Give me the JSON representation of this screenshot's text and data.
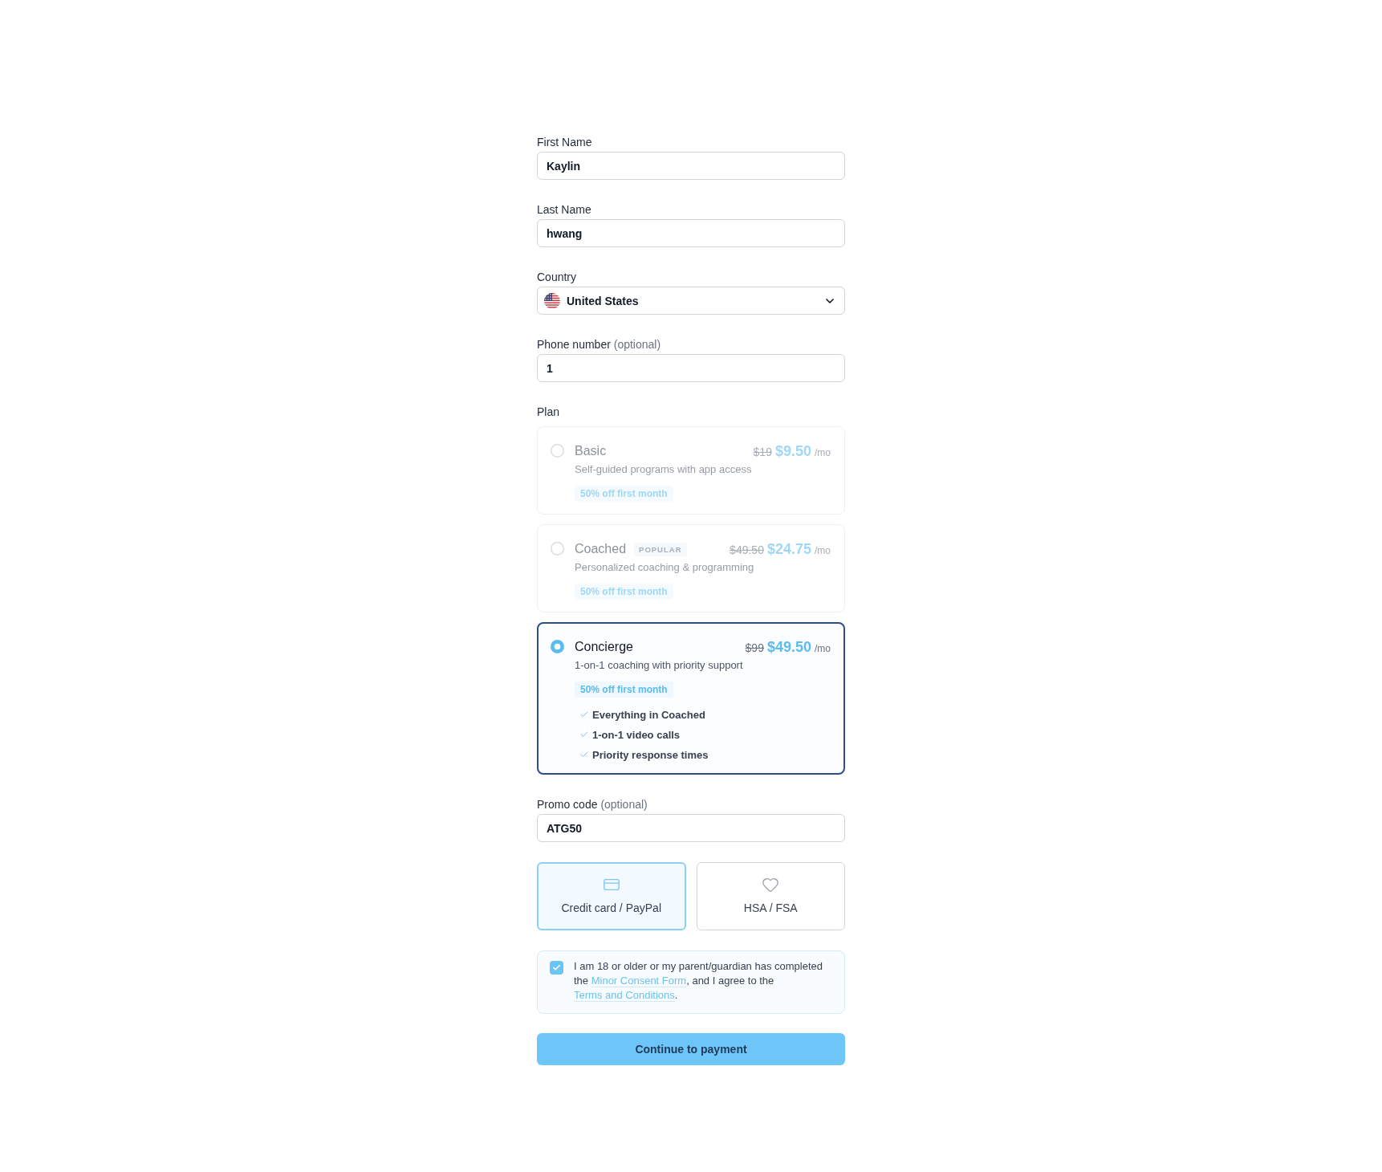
{
  "fields": [
    {
      "kind": "text",
      "label": "First Name",
      "value": "Kaylin"
    },
    {
      "kind": "text",
      "label": "Last Name",
      "value": "hwang"
    },
    {
      "kind": "select",
      "label": "Country",
      "value": "United States"
    },
    {
      "kind": "text",
      "label": "Phone number",
      "hint": "(optional)",
      "value": "1"
    }
  ],
  "plan": {
    "label": "Plan",
    "options": [
      {
        "name": "Basic",
        "old_price": "$19",
        "price": "$9.50",
        "period": "/mo",
        "description": "Self-guided programs with app access",
        "discount": "50% off first month",
        "selected": false
      },
      {
        "name": "Coached",
        "badge": "POPULAR",
        "old_price": "$49.50",
        "price": "$24.75",
        "period": "/mo",
        "description": "Personalized coaching & programming",
        "discount": "50% off first month",
        "selected": false
      },
      {
        "name": "Concierge",
        "old_price": "$99",
        "price": "$49.50",
        "period": "/mo",
        "description": "1-on-1 coaching with priority support",
        "discount": "50% off first month",
        "selected": true,
        "features": [
          "Everything in Coached",
          "1-on-1 video calls",
          "Priority response times"
        ]
      }
    ]
  },
  "promo": {
    "label": "Promo code",
    "hint": "(optional)",
    "value": "ATG50"
  },
  "payment_methods": [
    {
      "kind": "card",
      "label": "Credit card / PayPal",
      "selected": true
    },
    {
      "kind": "heart",
      "label": "HSA / FSA",
      "selected": false
    }
  ],
  "consent": {
    "checked": true,
    "parts": [
      {
        "kind": "text",
        "text": "I am 18 or older or my parent/guardian has completed the "
      },
      {
        "kind": "link",
        "text": "Minor Consent Form"
      },
      {
        "kind": "text",
        "text": ", and I agree to the "
      },
      {
        "kind": "link",
        "text": "Terms and Conditions"
      },
      {
        "kind": "text",
        "text": "."
      }
    ]
  },
  "submit": {
    "label": "Continue to payment"
  }
}
